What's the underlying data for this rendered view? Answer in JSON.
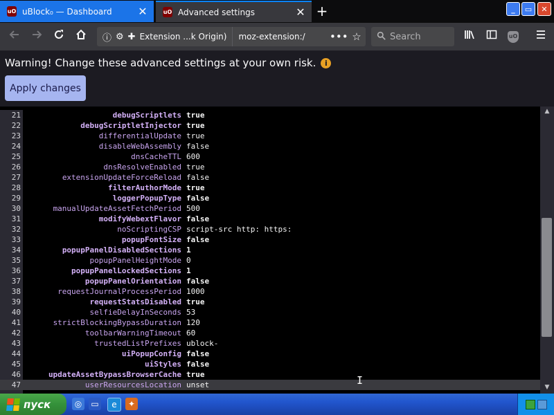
{
  "browser": {
    "tabs": [
      {
        "label": "uBlock₀ — Dashboard",
        "active": false
      },
      {
        "label": "Advanced settings",
        "active": true
      }
    ],
    "close_glyph": "✕",
    "new_tab_glyph": "+",
    "window_controls": {
      "minimize": "_",
      "maximize": "▭",
      "close": "✕"
    },
    "nav": {
      "identity_label": "Extension ...k Origin)",
      "address": "moz-extension:/",
      "search_placeholder": "Search"
    }
  },
  "page": {
    "warning": "Warning! Change these advanced settings at your own risk.",
    "warning_icon": "info-icon",
    "apply_label": "Apply changes"
  },
  "settings": [
    {
      "line": "21",
      "key": "debugScriptlets",
      "value": "true",
      "changed": true
    },
    {
      "line": "22",
      "key": "debugScriptletInjector",
      "value": "true",
      "changed": true
    },
    {
      "line": "23",
      "key": "differentialUpdate",
      "value": "true",
      "changed": false
    },
    {
      "line": "24",
      "key": "disableWebAssembly",
      "value": "false",
      "changed": false
    },
    {
      "line": "25",
      "key": "dnsCacheTTL",
      "value": "600",
      "changed": false
    },
    {
      "line": "26",
      "key": "dnsResolveEnabled",
      "value": "true",
      "changed": false
    },
    {
      "line": "27",
      "key": "extensionUpdateForceReload",
      "value": "false",
      "changed": false
    },
    {
      "line": "28",
      "key": "filterAuthorMode",
      "value": "true",
      "changed": true
    },
    {
      "line": "29",
      "key": "loggerPopupType",
      "value": "false",
      "changed": true
    },
    {
      "line": "30",
      "key": "manualUpdateAssetFetchPeriod",
      "value": "500",
      "changed": false
    },
    {
      "line": "31",
      "key": "modifyWebextFlavor",
      "value": "false",
      "changed": true
    },
    {
      "line": "32",
      "key": "noScriptingCSP",
      "value": "script-src http: https:",
      "changed": false
    },
    {
      "line": "33",
      "key": "popupFontSize",
      "value": "false",
      "changed": true
    },
    {
      "line": "34",
      "key": "popupPanelDisabledSections",
      "value": "1",
      "changed": true
    },
    {
      "line": "35",
      "key": "popupPanelHeightMode",
      "value": "0",
      "changed": false
    },
    {
      "line": "36",
      "key": "popupPanelLockedSections",
      "value": "1",
      "changed": true
    },
    {
      "line": "37",
      "key": "popupPanelOrientation",
      "value": "false",
      "changed": true
    },
    {
      "line": "38",
      "key": "requestJournalProcessPeriod",
      "value": "1000",
      "changed": false
    },
    {
      "line": "39",
      "key": "requestStatsDisabled",
      "value": "true",
      "changed": true
    },
    {
      "line": "40",
      "key": "selfieDelayInSeconds",
      "value": "53",
      "changed": false
    },
    {
      "line": "41",
      "key": "strictBlockingBypassDuration",
      "value": "120",
      "changed": false
    },
    {
      "line": "42",
      "key": "toolbarWarningTimeout",
      "value": "60",
      "changed": false
    },
    {
      "line": "43",
      "key": "trustedListPrefixes",
      "value": "ublock-",
      "changed": false
    },
    {
      "line": "44",
      "key": "uiPopupConfig",
      "value": "false",
      "changed": true
    },
    {
      "line": "45",
      "key": "uiStyles",
      "value": "false",
      "changed": true
    },
    {
      "line": "46",
      "key": "updateAssetBypassBrowserCache",
      "value": "true",
      "changed": true
    },
    {
      "line": "47",
      "key": "userResourcesLocation",
      "value": "unset",
      "changed": false,
      "current": true
    }
  ],
  "taskbar": {
    "start_label": "пуск",
    "quicklaunch": [
      "explorer-icon",
      "desktop-icon",
      "ie-icon",
      "firefox-icon"
    ]
  },
  "colors": {
    "accent": "#0a84ff",
    "apply_button": "#a6b5f0",
    "changed_key": "#d3b0f7",
    "key": "#c8a4ee",
    "taskbar": "#2155cd",
    "start_button": "#34913a"
  }
}
